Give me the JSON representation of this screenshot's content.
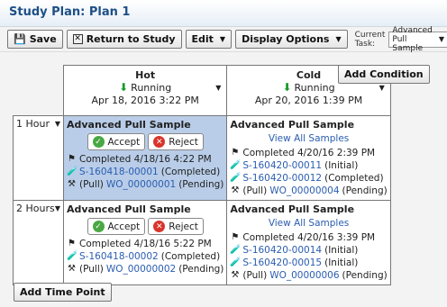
{
  "title": "Study Plan: Plan 1",
  "toolbar": {
    "save": "Save",
    "return": "Return to Study",
    "edit": "Edit",
    "display": "Display Options",
    "current_task_label": "Current Task:",
    "current_task_value": "Advanced Pull Sample"
  },
  "add_condition": "Add Condition",
  "add_time_point": "Add Time Point",
  "conditions": [
    {
      "name": "Hot",
      "status": "Running",
      "date": "Apr 18, 2016 3:22 PM"
    },
    {
      "name": "Cold",
      "status": "Running",
      "date": "Apr 20, 2016 1:39 PM"
    }
  ],
  "time_points": [
    {
      "label": "1 Hour",
      "cells": [
        {
          "title": "Advanced Pull Sample",
          "accept": "Accept",
          "reject": "Reject",
          "completed": "Completed 4/18/16 4:22 PM",
          "samples": [
            {
              "id": "S-160418-00001",
              "state": "(Completed)"
            }
          ],
          "pull_prefix": "(Pull)",
          "work_order": "WO_00000001",
          "wo_state": "(Pending)"
        },
        {
          "title": "Advanced Pull Sample",
          "view_all": "View All Samples",
          "completed": "Completed 4/20/16 2:39 PM",
          "samples": [
            {
              "id": "S-160420-00011",
              "state": "(Initial)"
            },
            {
              "id": "S-160420-00012",
              "state": "(Completed)"
            }
          ],
          "pull_prefix": "(Pull)",
          "work_order": "WO_00000004",
          "wo_state": "(Pending)"
        }
      ]
    },
    {
      "label": "2 Hours",
      "cells": [
        {
          "title": "Advanced Pull Sample",
          "accept": "Accept",
          "reject": "Reject",
          "completed": "Completed 4/18/16 5:22 PM",
          "samples": [
            {
              "id": "S-160418-00002",
              "state": "(Completed)"
            }
          ],
          "pull_prefix": "(Pull)",
          "work_order": "WO_00000002",
          "wo_state": "(Pending)"
        },
        {
          "title": "Advanced Pull Sample",
          "view_all": "View All Samples",
          "completed": "Completed 4/20/16 3:39 PM",
          "samples": [
            {
              "id": "S-160420-00014",
              "state": "(Initial)"
            },
            {
              "id": "S-160420-00015",
              "state": "(Initial)"
            }
          ],
          "pull_prefix": "(Pull)",
          "work_order": "WO_00000006",
          "wo_state": "(Pending)"
        }
      ]
    }
  ]
}
